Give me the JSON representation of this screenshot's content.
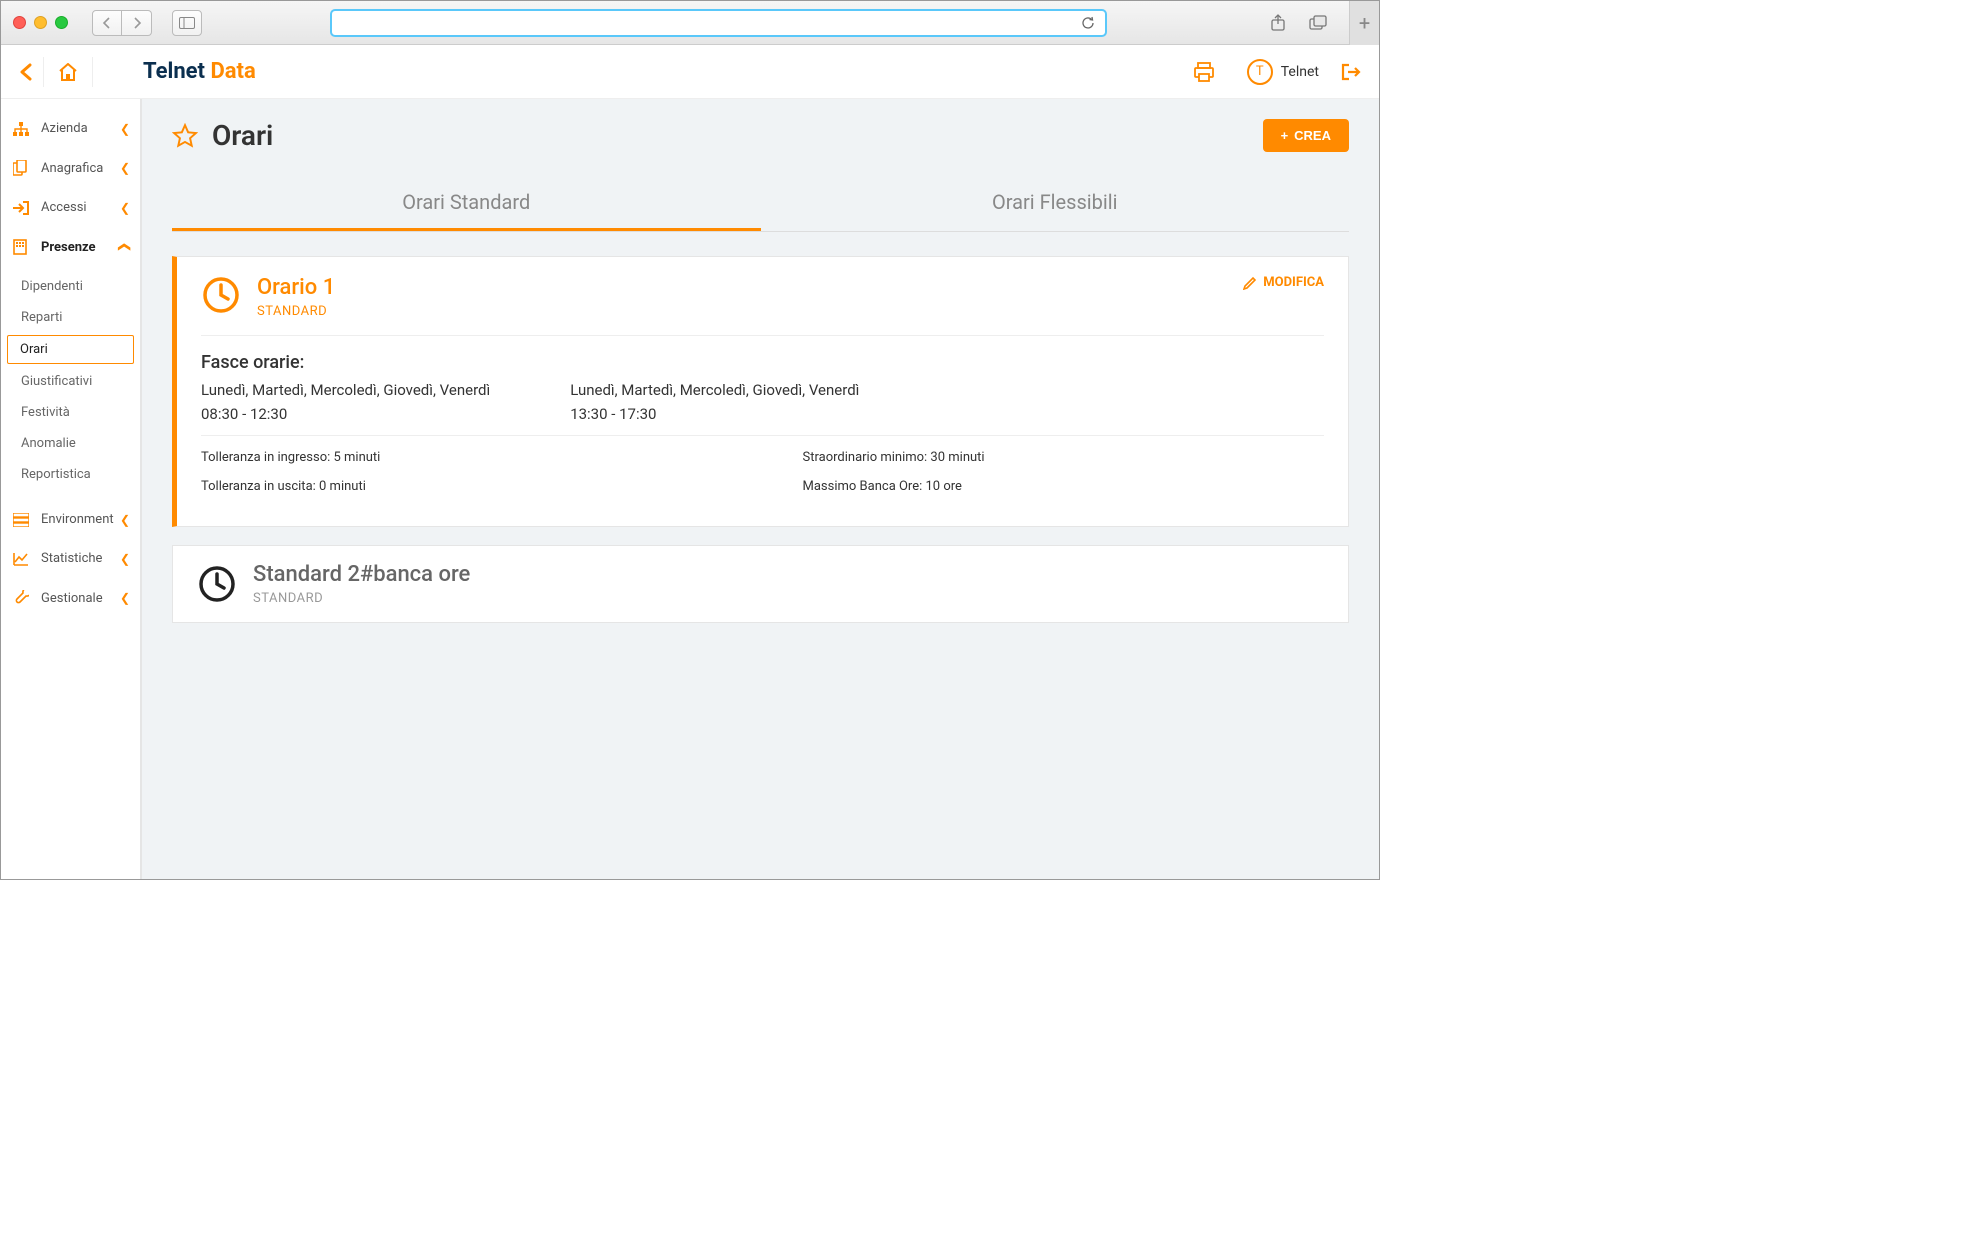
{
  "header": {
    "logo1": "Telnet",
    "logo2": "Data",
    "user_initial": "T",
    "user_name": "Telnet"
  },
  "sidebar": {
    "items": [
      {
        "label": "Azienda"
      },
      {
        "label": "Anagrafica"
      },
      {
        "label": "Accessi"
      },
      {
        "label": "Presenze"
      },
      {
        "label": "Environment"
      },
      {
        "label": "Statistiche"
      },
      {
        "label": "Gestionale"
      }
    ],
    "presenze_children": [
      {
        "label": "Dipendenti"
      },
      {
        "label": "Reparti"
      },
      {
        "label": "Orari"
      },
      {
        "label": "Giustificativi"
      },
      {
        "label": "Festività"
      },
      {
        "label": "Anomalie"
      },
      {
        "label": "Reportistica"
      }
    ]
  },
  "page": {
    "title": "Orari",
    "crea_label": "CREA",
    "tabs": {
      "standard": "Orari Standard",
      "flessibili": "Orari Flessibili"
    },
    "modify_label": "MODIFICA"
  },
  "schedule1": {
    "title": "Orario 1",
    "subtitle": "STANDARD",
    "fasce_heading": "Fasce orarie:",
    "col1_days": "Lunedì, Martedì, Mercoledì, Giovedì, Venerdì",
    "col1_time": "08:30 - 12:30",
    "col2_days": "Lunedì, Martedì, Mercoledì, Giovedì, Venerdì",
    "col2_time": "13:30 - 17:30",
    "meta": {
      "tol_in": "Tolleranza in ingresso: 5 minuti",
      "tol_out": "Tolleranza in uscita: 0 minuti",
      "extra_min": "Straordinario minimo: 30 minuti",
      "max_bank": "Massimo Banca Ore: 10 ore"
    }
  },
  "schedule2": {
    "title": "Standard 2#banca ore",
    "subtitle": "STANDARD"
  }
}
